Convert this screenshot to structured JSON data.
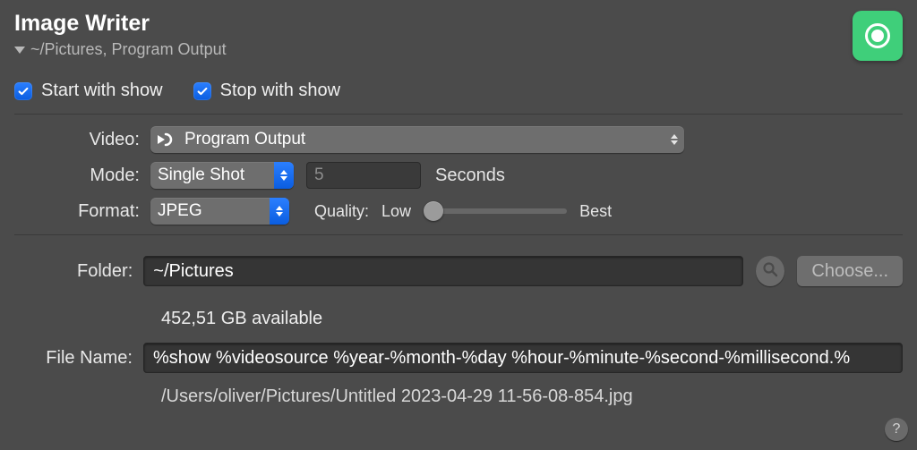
{
  "header": {
    "title": "Image Writer",
    "subtitle": "~/Pictures, Program Output"
  },
  "options": {
    "start_with_show": "Start with show",
    "stop_with_show": "Stop with show"
  },
  "video": {
    "label": "Video:",
    "selected": "Program Output"
  },
  "mode": {
    "label": "Mode:",
    "selected": "Single Shot",
    "interval_value": "5",
    "interval_unit": "Seconds"
  },
  "format": {
    "label": "Format:",
    "selected": "JPEG",
    "quality_label": "Quality:",
    "low_label": "Low",
    "best_label": "Best"
  },
  "folder": {
    "label": "Folder:",
    "value": "~/Pictures",
    "choose": "Choose...",
    "available": "452,51 GB available"
  },
  "filename": {
    "label": "File Name:",
    "value": "%show %videosource %year-%month-%day %hour-%minute-%second-%millisecond.%  ",
    "preview_path": "/Users/oliver/Pictures/Untitled 2023-04-29 11-56-08-854.jpg"
  },
  "help": "?"
}
